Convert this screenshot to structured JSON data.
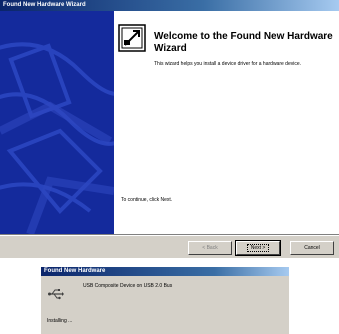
{
  "wizard": {
    "title": "Found New Hardware Wizard",
    "welcome_title": "Welcome to the Found New Hardware Wizard",
    "intro_text": "This wizard helps you install a device driver for a hardware device.",
    "continue_text": "To continue, click Next.",
    "buttons": {
      "back": "< Back",
      "next": "Next >",
      "cancel": "Cancel"
    },
    "icon": "hardware-installer-icon",
    "side_panel_color": "#142a9c"
  },
  "notification": {
    "title": "Found New Hardware",
    "device_name": "USB Composite Device on USB 2.0 Bus",
    "status": "Installing ...",
    "icon": "usb-icon"
  }
}
